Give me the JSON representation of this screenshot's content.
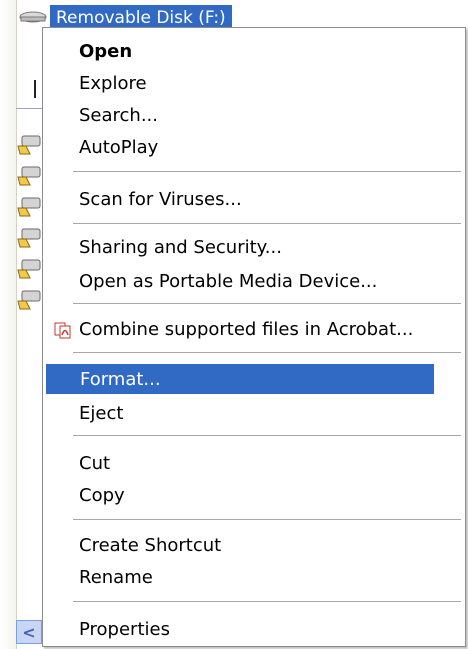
{
  "explorer": {
    "selected_drive": "Removable Disk (F:)",
    "scroll_left_arrow": "<"
  },
  "context_menu": {
    "items": [
      {
        "label": "Open",
        "bold": true
      },
      {
        "label": "Explore"
      },
      {
        "label": "Search..."
      },
      {
        "label": "AutoPlay"
      },
      {
        "label": "Scan for Viruses..."
      },
      {
        "label": "Sharing and Security..."
      },
      {
        "label": "Open as Portable Media Device..."
      },
      {
        "label": "Combine supported files in Acrobat...",
        "icon": "acrobat-icon"
      },
      {
        "label": "Format...",
        "selected": true
      },
      {
        "label": "Eject"
      },
      {
        "label": "Cut"
      },
      {
        "label": "Copy"
      },
      {
        "label": "Create Shortcut"
      },
      {
        "label": "Rename"
      },
      {
        "label": "Properties"
      }
    ]
  },
  "colors": {
    "highlight": "#316ac5",
    "separator": "#a7a6aa"
  }
}
